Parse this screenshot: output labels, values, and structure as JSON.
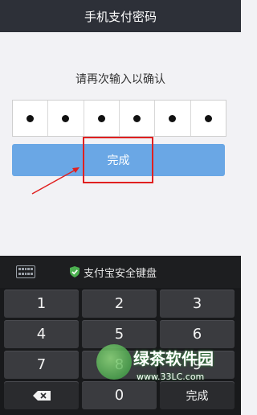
{
  "header": {
    "title": "手机支付密码"
  },
  "prompt": "请再次输入以确认",
  "pin": {
    "cells": 6,
    "filled": 6
  },
  "done_button": {
    "label": "完成"
  },
  "keyboard": {
    "title": "支付宝安全键盘",
    "keys": [
      "1",
      "2",
      "3",
      "4",
      "5",
      "6",
      "7",
      "8",
      "9",
      "",
      "0",
      "完成"
    ]
  },
  "watermark": {
    "text": "绿茶软件园",
    "url": "www.33LC.com"
  },
  "colors": {
    "accent": "#6aa7e5",
    "highlight": "#e02020",
    "header_bg": "#2d3038"
  }
}
